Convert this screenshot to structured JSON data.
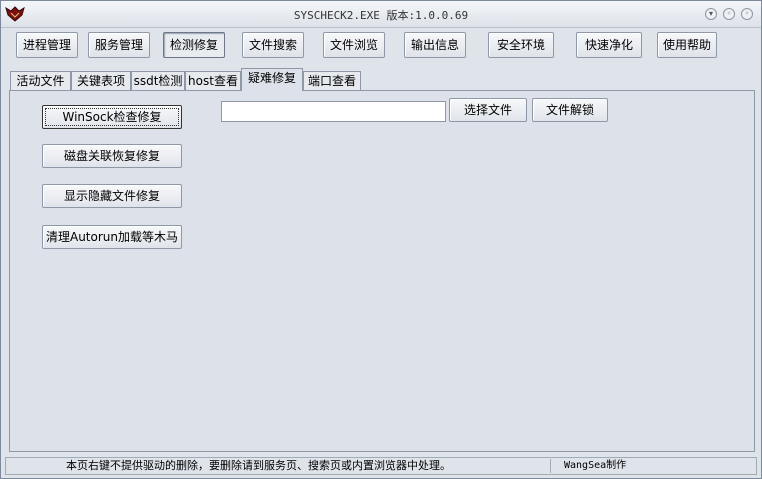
{
  "window": {
    "title": "SYSCHECK2.EXE  版本:1.0.0.69",
    "app_icon": "bat-logo-icon",
    "controls": [
      "minimize-icon",
      "maximize-icon",
      "close-icon"
    ]
  },
  "toolbar": {
    "buttons": [
      {
        "label": "进程管理"
      },
      {
        "label": "服务管理"
      },
      {
        "label": "检测修复"
      },
      {
        "label": "文件搜索"
      },
      {
        "label": "文件浏览"
      },
      {
        "label": "输出信息"
      },
      {
        "label": "安全环境"
      },
      {
        "label": "快速净化"
      },
      {
        "label": "使用帮助"
      }
    ],
    "active": "检测修复"
  },
  "tabs": {
    "items": [
      {
        "label": "活动文件"
      },
      {
        "label": "关键表项"
      },
      {
        "label": "ssdt检测"
      },
      {
        "label": "host查看"
      },
      {
        "label": "疑难修复"
      },
      {
        "label": "端口查看"
      }
    ],
    "active": "疑难修复"
  },
  "repair": {
    "winsock_label": "WinSock检查修复",
    "disk_assoc_label": "磁盘关联恢复修复",
    "show_hidden_label": "显示隐藏文件修复",
    "autorun_label": "清理Autorun加载等木马",
    "file_path_value": "",
    "select_file_label": "选择文件",
    "unlock_file_label": "文件解锁"
  },
  "status": {
    "message": "本页右键不提供驱动的删除，要删除请到服务页、搜索页或内置浏览器中处理。",
    "credit": "WangSea制作"
  }
}
